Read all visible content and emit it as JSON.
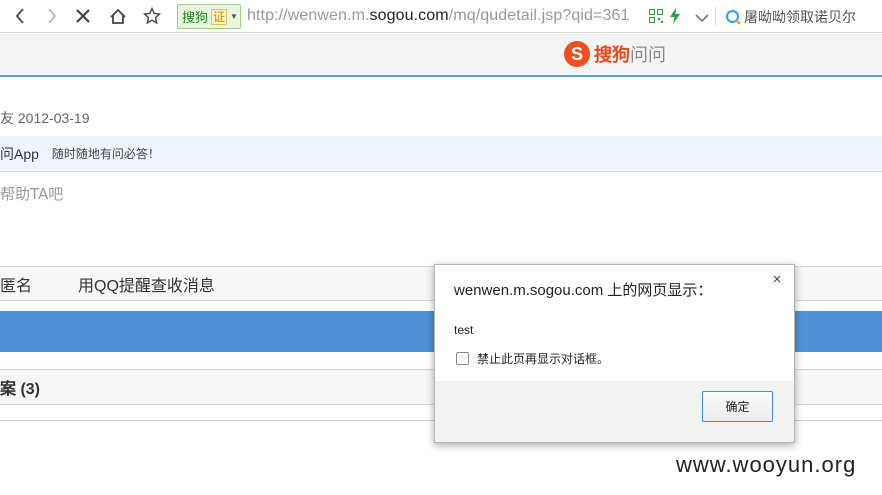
{
  "browser": {
    "cert_label": "搜狗",
    "cert_badge": "证",
    "url_prefix": "http://wenwen.m.",
    "url_domain": "sogou.com",
    "url_suffix": "/mq/qudetail.jsp?qid=361",
    "search_text": "屠呦呦领取诺贝尔",
    "icons": [
      "back-icon",
      "forward-icon",
      "stop-icon",
      "home-icon",
      "bookmark-star-icon",
      "qr-code-icon",
      "lightning-icon",
      "dropdown-icon",
      "search-engine-icon"
    ]
  },
  "site": {
    "logo_letter": "S",
    "logo_sou": "搜狗",
    "logo_wen": "问问",
    "brand_color": "#e8491d"
  },
  "question": {
    "date_line": "友 2012-03-19",
    "app_name": "问App",
    "app_slogan": "随时随地有问必答！",
    "help_hint": "帮助TA吧",
    "option_anonymous": "匿名",
    "option_qq_notify": "用QQ提醒查收消息",
    "answers_header": "案 (3)"
  },
  "dialog": {
    "title": "wenwen.m.sogou.com 上的网页显示：",
    "close": "×",
    "message": "test",
    "checkbox_label": "禁止此页再显示对话框。",
    "ok_label": "确定"
  },
  "watermark": "www.wooyun.org"
}
